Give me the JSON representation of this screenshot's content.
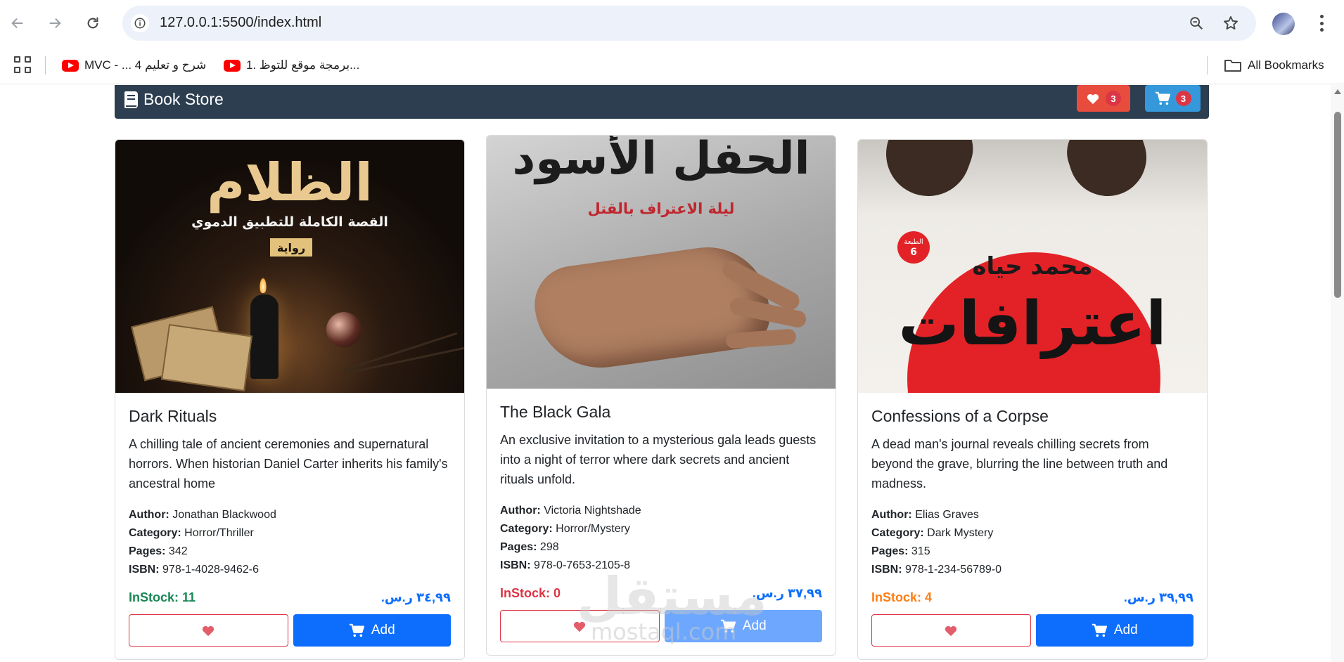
{
  "browser": {
    "url": "127.0.0.1:5500/index.html",
    "bookmarks": [
      {
        "label": "MVC - ... شرح و تعليم 4",
        "icon": "youtube-icon"
      },
      {
        "label": "1. برمجة موقع للتوظ...",
        "icon": "youtube-icon"
      }
    ],
    "all_bookmarks_label": "All Bookmarks"
  },
  "navbar": {
    "brand": "Book Store",
    "favorites_count": "3",
    "cart_count": "3",
    "colors": {
      "bar": "#2c3e50",
      "favorites": "#e74c3c",
      "cart": "#3498db"
    }
  },
  "labels": {
    "author": "Author:",
    "category": "Category:",
    "pages": "Pages:",
    "isbn": "ISBN:",
    "instock": "InStock:",
    "add": "Add"
  },
  "books": [
    {
      "title": "Dark Rituals",
      "description": "A chilling tale of ancient ceremonies and supernatural horrors. When historian Daniel Carter inherits his family's ancestral home",
      "author": "Jonathan Blackwood",
      "category": "Horror/Thriller",
      "pages": "342",
      "isbn": "978-1-4028-9462-6",
      "instock": "11",
      "stock_color": "#198754",
      "price": "٣٤,٩٩ ر.س.",
      "cover_title": "الظلام",
      "cover_subtitle": "القصة الكاملة للتطبيق الدموي",
      "cover_tag": "رواية"
    },
    {
      "title": "The Black Gala",
      "description": "An exclusive invitation to a mysterious gala leads guests into a night of terror where dark secrets and ancient rituals unfold.",
      "author": "Victoria Nightshade",
      "category": "Horror/Mystery",
      "pages": "298",
      "isbn": "978-0-7653-2105-8",
      "instock": "0",
      "stock_color": "#dc3545",
      "price": "٣٧,٩٩ ر.س.",
      "cover_title": "الحفل الأسود",
      "cover_subtitle": "ليلة الاعتراف بالقتل"
    },
    {
      "title": "Confessions of a Corpse",
      "description": "A dead man's journal reveals chilling secrets from beyond the grave, blurring the line between truth and madness.",
      "author": "Elias Graves",
      "category": "Dark Mystery",
      "pages": "315",
      "isbn": "978-1-234-56789-0",
      "instock": "4",
      "stock_color": "#fd7e14",
      "price": "٣٩,٩٩ ر.س.",
      "cover_title": "اعترافات",
      "cover_author": "محمد حياه",
      "cover_badge_top": "الطبعة",
      "cover_badge_num": "6"
    }
  ],
  "watermark": {
    "main": "مستقل",
    "sub": "mostaql.com"
  }
}
